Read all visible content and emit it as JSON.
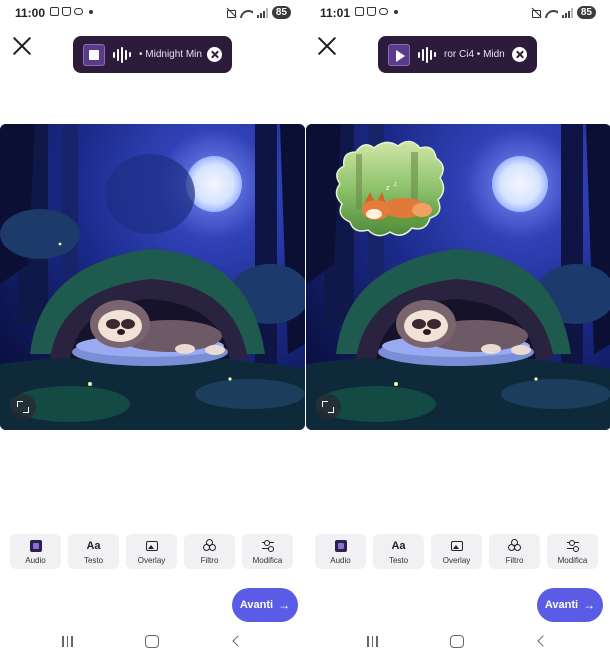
{
  "screens": [
    {
      "status": {
        "time": "11:00",
        "battery": "85"
      },
      "music": {
        "track": "• Midnight Min",
        "state": "stop"
      },
      "tools": [
        {
          "label": "Audio",
          "icon": "audio-icon"
        },
        {
          "label": "Testo",
          "icon": "text-aa-icon",
          "glyph": "Aa"
        },
        {
          "label": "Overlay",
          "icon": "image-icon"
        },
        {
          "label": "Filtro",
          "icon": "filter-icon"
        },
        {
          "label": "Modifica",
          "icon": "sliders-icon"
        }
      ],
      "next_label": "Avanti",
      "has_overlay": false
    },
    {
      "status": {
        "time": "11:01",
        "battery": "85"
      },
      "music": {
        "track": "ror    Ci4 • Midn",
        "state": "play"
      },
      "tools": [
        {
          "label": "Audio",
          "icon": "audio-icon"
        },
        {
          "label": "Testo",
          "icon": "text-aa-icon",
          "glyph": "Aa"
        },
        {
          "label": "Overlay",
          "icon": "image-icon"
        },
        {
          "label": "Filtro",
          "icon": "filter-icon"
        },
        {
          "label": "Modifica",
          "icon": "sliders-icon"
        }
      ],
      "next_label": "Avanti",
      "has_overlay": true
    }
  ],
  "colors": {
    "accent": "#5b5ce6",
    "pill_bg": "#2d1b3b",
    "tool_bg": "#f1f1f4"
  }
}
